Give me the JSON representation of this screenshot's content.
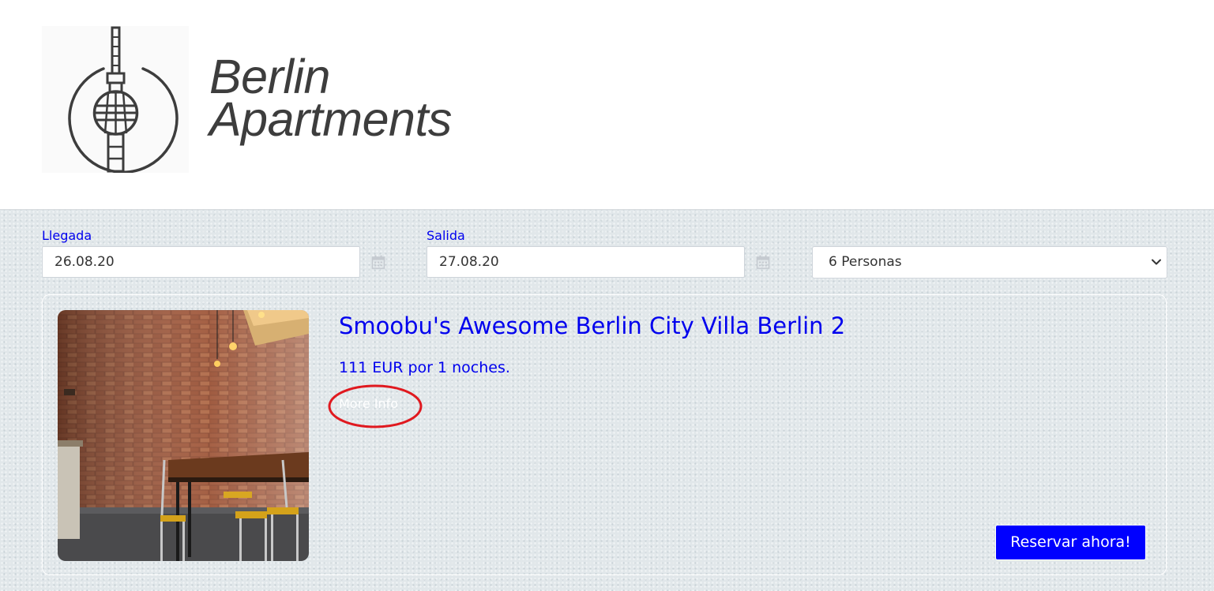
{
  "header": {
    "brand_line1": "Berlin",
    "brand_line2": "Apartments",
    "logo_icon": "tv-tower-icon"
  },
  "search": {
    "arrival_label": "Llegada",
    "arrival_value": "26.08.20",
    "departure_label": "Salida",
    "departure_value": "27.08.20",
    "guests_selected": "6 Personas",
    "calendar_icon": "calendar-icon",
    "dropdown_icon": "chevron-down-icon"
  },
  "listing": {
    "title": "Smoobu's Awesome Berlin City Villa Berlin 2",
    "price": "111 EUR por 1 noches.",
    "more_info": "More Info",
    "book_button": "Reservar ahora!"
  },
  "colors": {
    "link_blue": "#0000ee",
    "button_blue": "#0000ff",
    "annotation_red": "#e0191f",
    "background": "#e1e7ea",
    "logo_gray": "#3d3d3d"
  }
}
